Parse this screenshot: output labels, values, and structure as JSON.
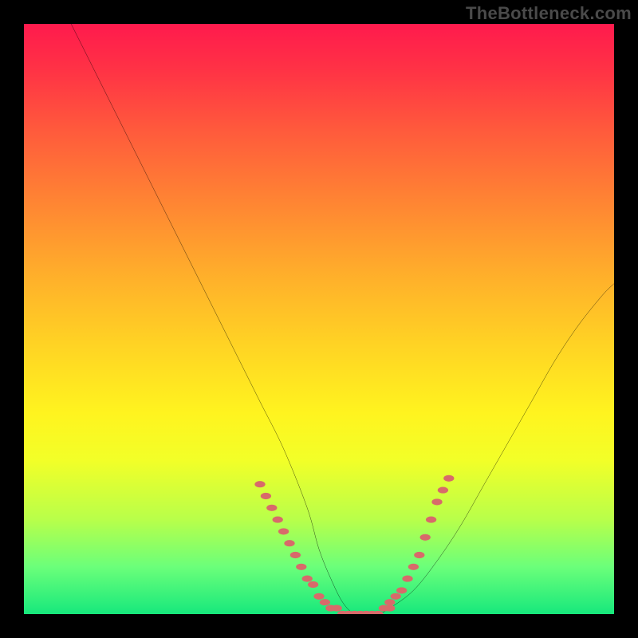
{
  "watermark": "TheBottleneck.com",
  "chart_data": {
    "type": "line",
    "title": "",
    "xlabel": "",
    "ylabel": "",
    "xlim": [
      0,
      100
    ],
    "ylim": [
      0,
      100
    ],
    "grid": false,
    "legend": false,
    "series": [
      {
        "name": "bottleneck-curve",
        "color": "#000000",
        "x": [
          8,
          12,
          16,
          20,
          24,
          28,
          32,
          36,
          40,
          44,
          48,
          50,
          52,
          54,
          56,
          58,
          60,
          62,
          66,
          70,
          74,
          78,
          82,
          86,
          90,
          94,
          98,
          100
        ],
        "y": [
          100,
          92,
          84,
          76,
          68,
          60,
          52,
          44,
          36,
          28,
          18,
          11,
          6,
          2,
          0,
          0,
          0,
          1,
          4,
          9,
          15,
          22,
          29,
          36,
          43,
          49,
          54,
          56
        ]
      },
      {
        "name": "highlight-dots-left",
        "color": "#d86a6a",
        "x": [
          40,
          41,
          42,
          43,
          44,
          45,
          46,
          47,
          48,
          49,
          50,
          51,
          52,
          53,
          54
        ],
        "y": [
          22,
          20,
          18,
          16,
          14,
          12,
          10,
          8,
          6,
          5,
          3,
          2,
          1,
          1,
          0
        ]
      },
      {
        "name": "highlight-dots-bottom",
        "color": "#d86a6a",
        "x": [
          54,
          55,
          56,
          57,
          58,
          59,
          60,
          61,
          62
        ],
        "y": [
          0,
          0,
          0,
          0,
          0,
          0,
          0,
          1,
          1
        ]
      },
      {
        "name": "highlight-dots-right",
        "color": "#d86a6a",
        "x": [
          62,
          63,
          64,
          65,
          66,
          67,
          68,
          69,
          70,
          71,
          72
        ],
        "y": [
          2,
          3,
          4,
          6,
          8,
          10,
          13,
          16,
          19,
          21,
          23
        ]
      }
    ],
    "gradient_stops": [
      {
        "pos": 0,
        "color": "#ff1a4d"
      },
      {
        "pos": 18,
        "color": "#ff5a3c"
      },
      {
        "pos": 42,
        "color": "#ffad2b"
      },
      {
        "pos": 66,
        "color": "#fff41f"
      },
      {
        "pos": 84,
        "color": "#b8ff4a"
      },
      {
        "pos": 100,
        "color": "#17e87c"
      }
    ]
  }
}
